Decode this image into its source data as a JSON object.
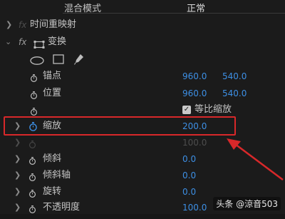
{
  "blend": {
    "label": "混合模式",
    "value": "正常"
  },
  "time_remap": {
    "fx": "fx",
    "label": "时间重映射"
  },
  "transform": {
    "fx": "fx",
    "label": "变换"
  },
  "properties": {
    "anchor": {
      "label": "锚点",
      "x": "960.0",
      "y": "540.0"
    },
    "position": {
      "label": "位置",
      "x": "960.0",
      "y": "540.0"
    },
    "uniform": {
      "label": "等比缩放"
    },
    "scale": {
      "label": "缩放",
      "value": "200.0"
    },
    "scale_width": {
      "value": "100.0"
    },
    "skew": {
      "label": "倾斜",
      "value": "0.0"
    },
    "skew_axis": {
      "label": "倾斜轴",
      "value": "0.0"
    },
    "rotation": {
      "label": "旋转",
      "value": "0.0"
    },
    "opacity": {
      "label": "不透明度",
      "value": "100.0"
    }
  },
  "watermark": "头条 @涼音503",
  "colors": {
    "value_blue": "#3d8fe4",
    "highlight_red": "#d8282a"
  }
}
